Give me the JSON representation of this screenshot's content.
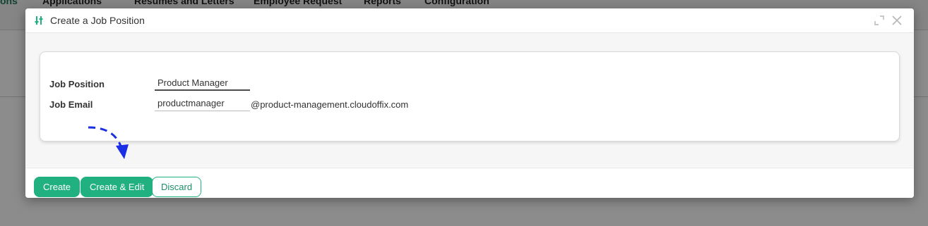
{
  "background_app": {
    "nav_left": "ons",
    "nav_items": [
      "Applications",
      "Resumes and Letters",
      "Employee Request",
      "Reports",
      "Configuration"
    ]
  },
  "dialog": {
    "title": "Create a Job Position",
    "header_icon": "job-position-icon",
    "expand_icon": "expand-icon",
    "close_icon": "close-icon"
  },
  "form": {
    "job_position": {
      "label": "Job Position",
      "value": "Product Manager"
    },
    "job_email": {
      "label": "Job Email",
      "value": "productmanager",
      "suffix": "@product-management.cloudoffix.com"
    }
  },
  "footer": {
    "create_label": "Create",
    "create_edit_label": "Create & Edit",
    "discard_label": "Discard"
  },
  "colors": {
    "primary": "#21b07f",
    "annotation_arrow": "#1a2ee6"
  }
}
